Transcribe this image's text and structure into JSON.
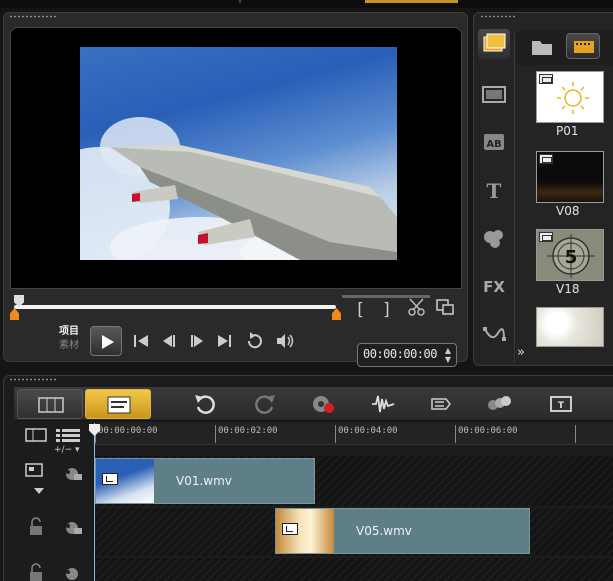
{
  "preview": {
    "mode_project": "项目",
    "mode_clip": "素材",
    "timecode": "00:00:00:00",
    "bracket_in": "[",
    "bracket_out": "]"
  },
  "library": {
    "items": [
      {
        "label": "P01"
      },
      {
        "label": "V08"
      },
      {
        "label": "V18"
      }
    ],
    "expand_glyph": "»"
  },
  "timeline": {
    "zoom_label": "+/− ▾",
    "ruler": [
      "00:00:00:00",
      "00:00:02:00",
      "00:00:04:00",
      "00:00:06:00"
    ],
    "clips": [
      {
        "name": "V01.wmv"
      },
      {
        "name": "V05.wmv"
      }
    ]
  },
  "colors": {
    "accent": "#c8941e",
    "clip": "#5f7f88",
    "marker": "#f08a18"
  }
}
